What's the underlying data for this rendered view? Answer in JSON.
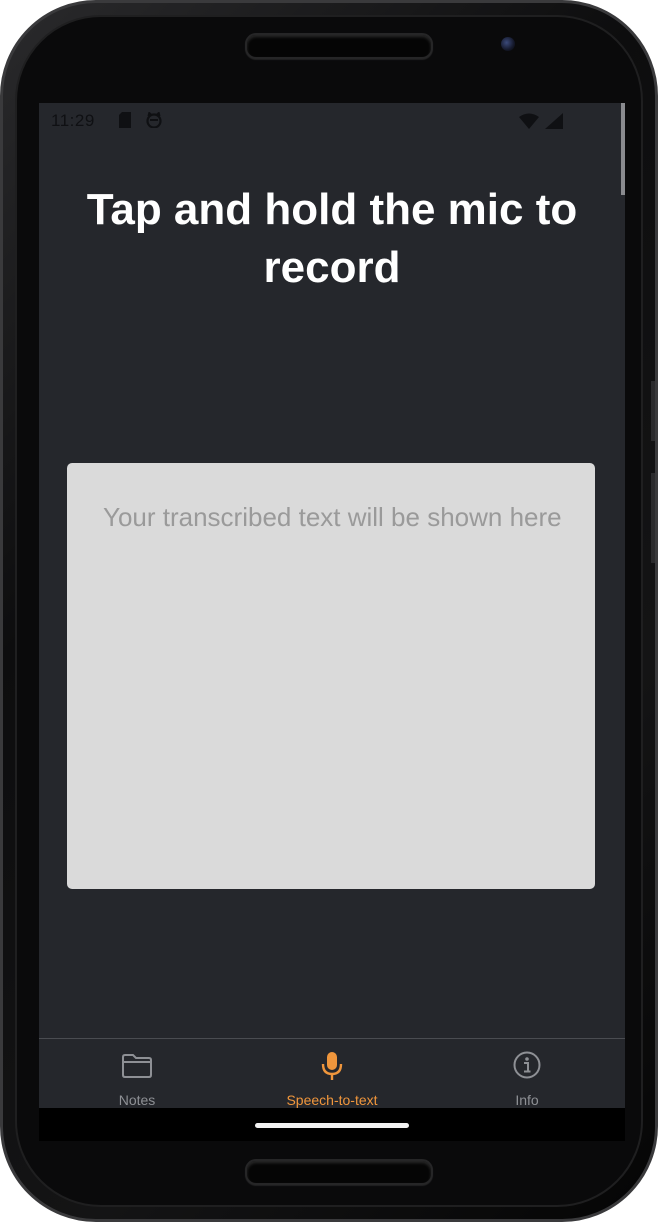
{
  "status_bar": {
    "time": "11:29",
    "icons": [
      "sd-card-icon",
      "cat-face-icon",
      "wifi-icon",
      "cell-signal-icon"
    ]
  },
  "main": {
    "title": "Tap and hold the mic to record",
    "transcript_placeholder": "Your transcribed text will be shown here"
  },
  "bottom_nav": {
    "items": [
      {
        "label": "Notes",
        "icon": "folder-icon",
        "active": false
      },
      {
        "label": "Speech-to-text",
        "icon": "microphone-icon",
        "active": true
      },
      {
        "label": "Info",
        "icon": "info-icon",
        "active": false
      }
    ]
  },
  "colors": {
    "background": "#25272c",
    "accent": "#f0963c",
    "nav_inactive": "#8e9095",
    "transcript_box": "#dadada",
    "placeholder_text": "#9a9a9a"
  }
}
